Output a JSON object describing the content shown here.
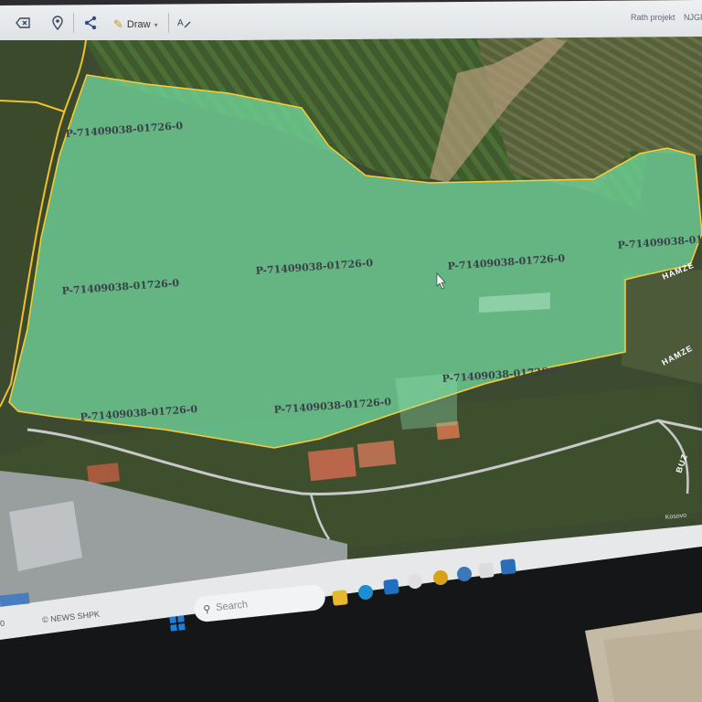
{
  "toolbar": {
    "draw_label": "Draw",
    "right_label_1": "Rath projekt",
    "right_label_2": "NJGF",
    "icons": [
      "erase-icon",
      "location-pin-icon",
      "share-icon",
      "pencil-icon",
      "text-tool-icon"
    ]
  },
  "map": {
    "parcel_fill_color": "#6fd39a",
    "parcel_labels": [
      "P-71409038-01726-0",
      "P-71409038-01726-0",
      "P-71409038-01726-0",
      "P-71409038-01726-0",
      "P-71409038-01726-0",
      "P-71409038-01726-0",
      "P-71409038-01726-0",
      "P-71409038-01726-0",
      "P-71409038-01726-0"
    ],
    "road_labels": [
      "HAMZE",
      "HAMZE",
      "BUZ"
    ],
    "corner_label": "Kosovo"
  },
  "footer": {
    "scale_text": "0",
    "attribution": "© NEWS SHPK"
  },
  "taskbar": {
    "search_placeholder": "Search"
  }
}
